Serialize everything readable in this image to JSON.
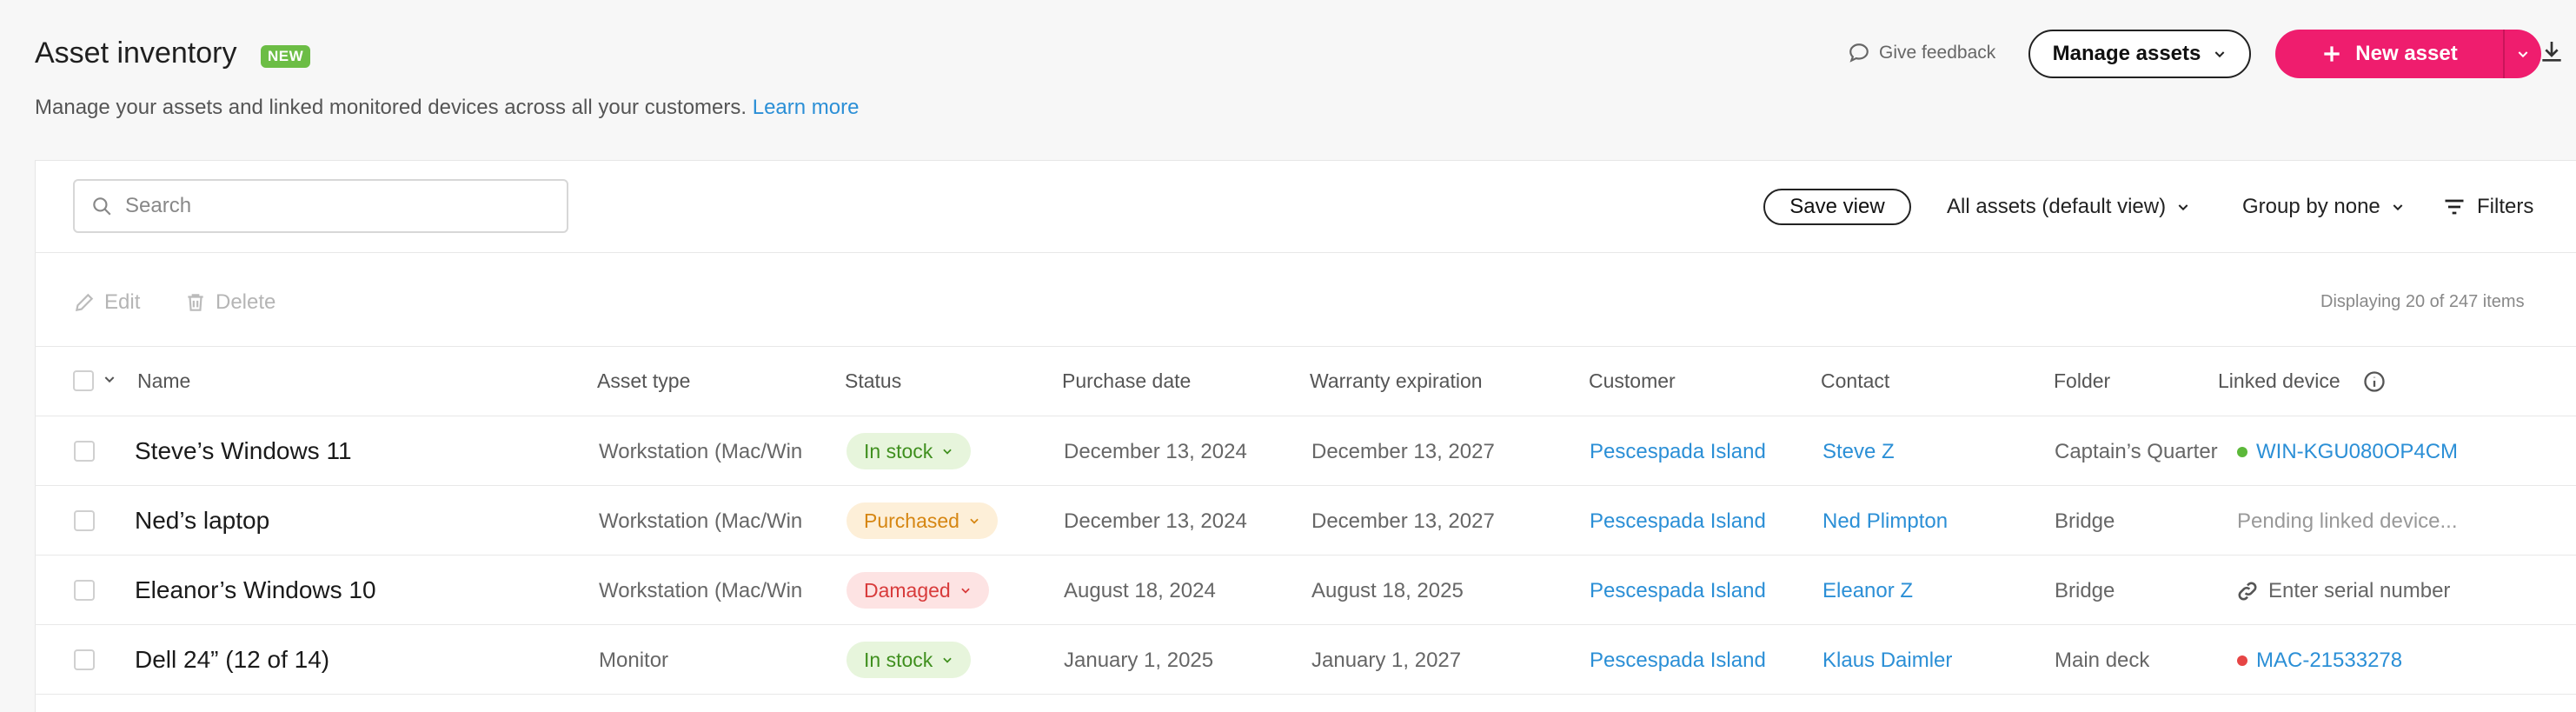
{
  "header": {
    "title": "Asset inventory",
    "badge": "NEW",
    "subtitle": "Manage your assets and linked monitored devices across all your customers.",
    "learn_more": "Learn more",
    "feedback": "Give feedback",
    "manage_assets": "Manage assets",
    "new_asset": "New asset"
  },
  "toolbar": {
    "search_placeholder": "Search",
    "save_view": "Save view",
    "view": "All assets (default view)",
    "group_by": "Group by none",
    "filters": "Filters",
    "edit": "Edit",
    "delete": "Delete",
    "displaying": "Displaying 20 of 247 items"
  },
  "table": {
    "columns": [
      "Name",
      "Asset type",
      "Status",
      "Purchase date",
      "Warranty expiration",
      "Customer",
      "Contact",
      "Folder",
      "Linked device"
    ],
    "rows": [
      {
        "name": "Steve’s Windows 11",
        "asset_type": "Workstation (Mac/Win",
        "status": "In stock",
        "purchase": "December 13, 2024",
        "warranty": "December 13, 2027",
        "customer": "Pescespada Island",
        "contact": "Steve Z",
        "folder": "Captain’s Quarter",
        "linked": "WIN-KGU080OP4CM"
      },
      {
        "name": "Ned’s laptop",
        "asset_type": "Workstation (Mac/Win",
        "status": "Purchased",
        "purchase": "December 13, 2024",
        "warranty": "December 13, 2027",
        "customer": "Pescespada Island",
        "contact": "Ned Plimpton",
        "folder": "Bridge",
        "linked": "Pending linked device..."
      },
      {
        "name": "Eleanor’s Windows 10",
        "asset_type": "Workstation (Mac/Win",
        "status": "Damaged",
        "purchase": "August 18, 2024",
        "warranty": "August 18, 2025",
        "customer": "Pescespada Island",
        "contact": "Eleanor Z",
        "folder": "Bridge",
        "linked": "Enter serial number"
      },
      {
        "name": "Dell 24” (12 of 14)",
        "asset_type": "Monitor",
        "status": "In stock",
        "purchase": "January 1, 2025",
        "warranty": "January 1, 2027",
        "customer": "Pescespada Island",
        "contact": "Klaus Daimler",
        "folder": "Main deck",
        "linked": "MAC-21533278"
      }
    ]
  },
  "colors": {
    "accent": "#ef1d6e",
    "link": "#2b8fd6",
    "badge": "#6cbd45",
    "online": "#5cb83a",
    "offline": "#e64545"
  }
}
